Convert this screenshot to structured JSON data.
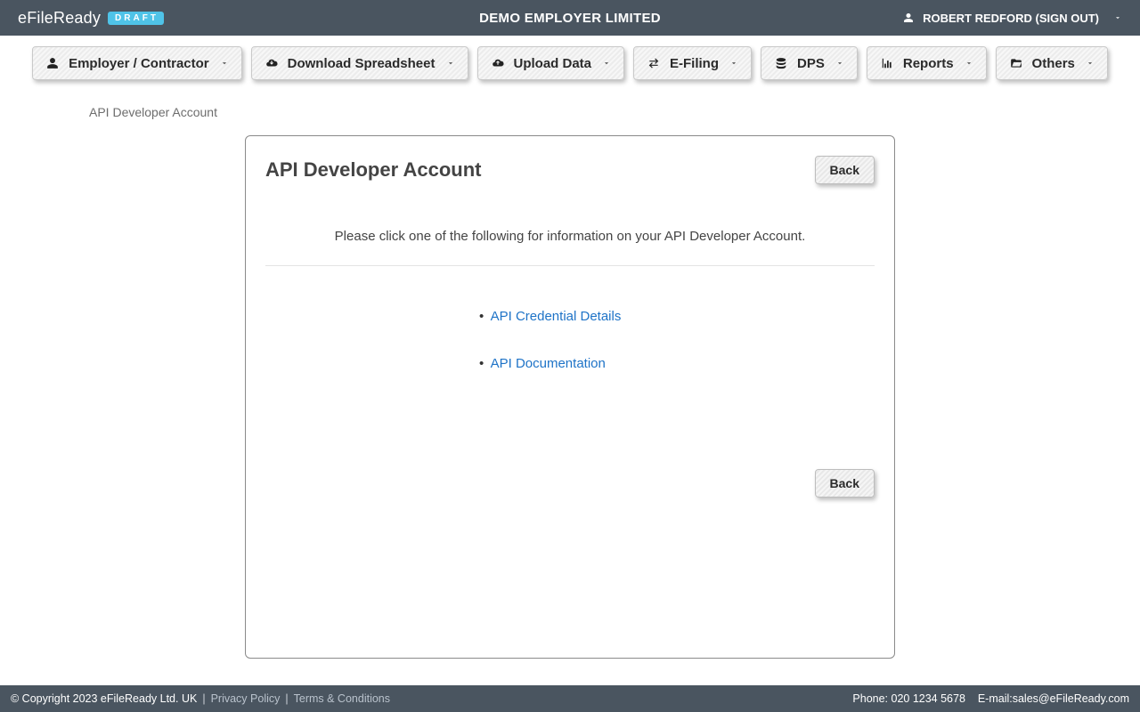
{
  "brand": {
    "name": "eFileReady",
    "badge": "DRAFT"
  },
  "header": {
    "company": "DEMO EMPLOYER LIMITED",
    "user_label": "ROBERT REDFORD (SIGN OUT)"
  },
  "menu": {
    "items": [
      {
        "label": "Employer / Contractor"
      },
      {
        "label": "Download Spreadsheet"
      },
      {
        "label": "Upload Data"
      },
      {
        "label": "E-Filing"
      },
      {
        "label": "DPS"
      },
      {
        "label": "Reports"
      },
      {
        "label": "Others"
      }
    ]
  },
  "breadcrumb": "API Developer Account",
  "card": {
    "title": "API Developer Account",
    "back_label": "Back",
    "intro": "Please click one of the following for information on your API Developer Account.",
    "links": [
      {
        "label": "API Credential Details"
      },
      {
        "label": "API Documentation"
      }
    ]
  },
  "footer": {
    "copyright": "© Copyright 2023  eFileReady Ltd. UK",
    "privacy": "Privacy Policy",
    "terms": "Terms & Conditions",
    "phone_label": "Phone: 020 1234 5678",
    "email_label": "E-mail:",
    "email": "sales@eFileReady.com"
  }
}
